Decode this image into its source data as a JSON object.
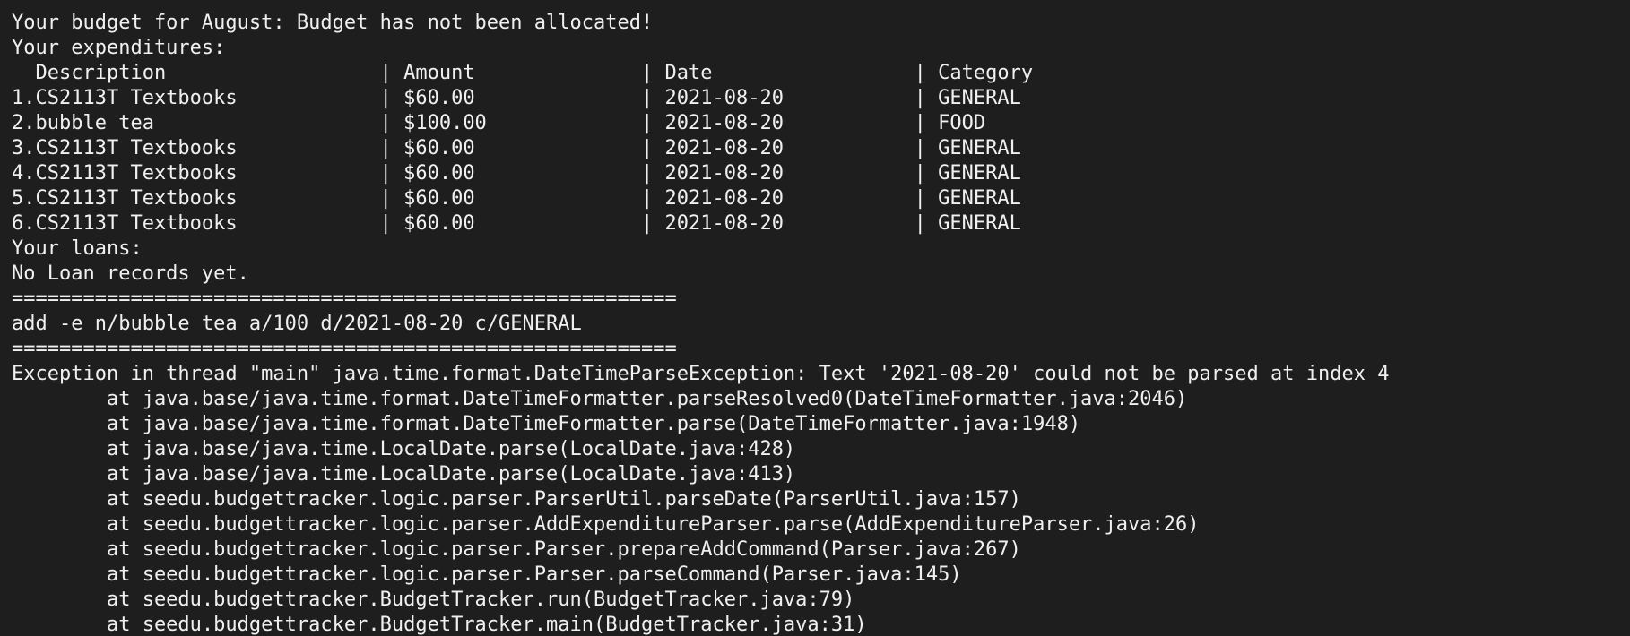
{
  "terminal": {
    "lines": [
      "========================================================",
      "Your budget for August: Budget has not been allocated!",
      "Your expenditures:",
      "  Description                  | Amount              | Date                 | Category",
      "1.CS2113T Textbooks            | $60.00              | 2021-08-20           | GENERAL",
      "2.bubble tea                   | $100.00             | 2021-08-20           | FOOD",
      "3.CS2113T Textbooks            | $60.00              | 2021-08-20           | GENERAL",
      "4.CS2113T Textbooks            | $60.00              | 2021-08-20           | GENERAL",
      "5.CS2113T Textbooks            | $60.00              | 2021-08-20           | GENERAL",
      "6.CS2113T Textbooks            | $60.00              | 2021-08-20           | GENERAL",
      "Your loans:",
      "No Loan records yet.",
      "========================================================",
      "add -e n/bubble tea a/100 d/2021-08-20 c/GENERAL",
      "========================================================",
      "Exception in thread \"main\" java.time.format.DateTimeParseException: Text '2021-08-20' could not be parsed at index 4",
      "        at java.base/java.time.format.DateTimeFormatter.parseResolved0(DateTimeFormatter.java:2046)",
      "        at java.base/java.time.format.DateTimeFormatter.parse(DateTimeFormatter.java:1948)",
      "        at java.base/java.time.LocalDate.parse(LocalDate.java:428)",
      "        at java.base/java.time.LocalDate.parse(LocalDate.java:413)",
      "        at seedu.budgettracker.logic.parser.ParserUtil.parseDate(ParserUtil.java:157)",
      "        at seedu.budgettracker.logic.parser.AddExpenditureParser.parse(AddExpenditureParser.java:26)",
      "        at seedu.budgettracker.logic.parser.Parser.prepareAddCommand(Parser.java:267)",
      "        at seedu.budgettracker.logic.parser.Parser.parseCommand(Parser.java:145)",
      "        at seedu.budgettracker.BudgetTracker.run(BudgetTracker.java:79)",
      "        at seedu.budgettracker.BudgetTracker.main(BudgetTracker.java:31)"
    ]
  }
}
